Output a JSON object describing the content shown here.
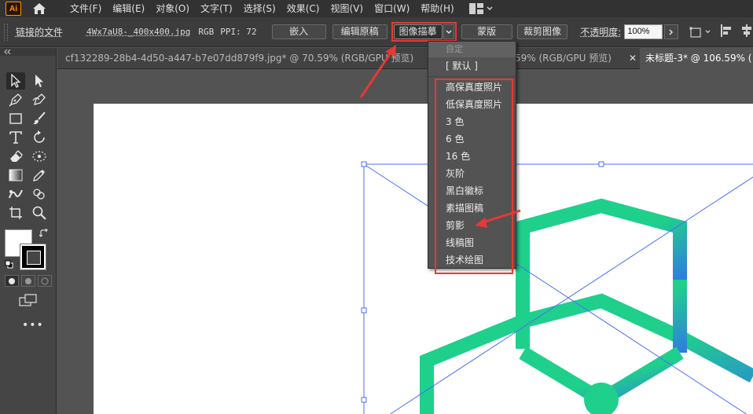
{
  "menubar": {
    "app_logo": "Ai",
    "items": [
      "文件(F)",
      "编辑(E)",
      "对象(O)",
      "文字(T)",
      "选择(S)",
      "效果(C)",
      "视图(V)",
      "窗口(W)",
      "帮助(H)"
    ]
  },
  "controlbar": {
    "linked_file_label": "链接的文件",
    "filename": "4Wx7aU8-_400x400.jpg",
    "color_mode": "RGB",
    "ppi_label": "PPI: 72",
    "embed_button": "嵌入",
    "edit_original_button": "编辑原稿",
    "image_trace_button": "图像描摹",
    "mask_button": "蒙版",
    "crop_image_button": "裁剪图像",
    "opacity_label": "不透明度:",
    "opacity_value": "100%"
  },
  "tabs": [
    {
      "label": "cf132289-28b4-4d50-a447-b7e07dd879f9.jpg* @ 70.59% (RGB/GPU 预览)",
      "active": false
    },
    {
      "label": "59% (RGB/GPU 预览)",
      "active": false
    },
    {
      "label": "未标题-3* @ 106.59% (",
      "active": true
    }
  ],
  "trace_dropdown": {
    "header": "自定",
    "default_item": "[ 默认 ]",
    "items": [
      "高保真度照片",
      "低保真度照片",
      "3 色",
      "6 色",
      "16 色",
      "灰阶",
      "黑白徽标",
      "素描图稿",
      "剪影",
      "线稿图",
      "技术绘图"
    ]
  },
  "colors": {
    "accent_highlight": "#e53935",
    "logo_green": "#1fcf8c",
    "logo_blue": "#2f7de0",
    "selection_blue": "#4a6cff"
  }
}
